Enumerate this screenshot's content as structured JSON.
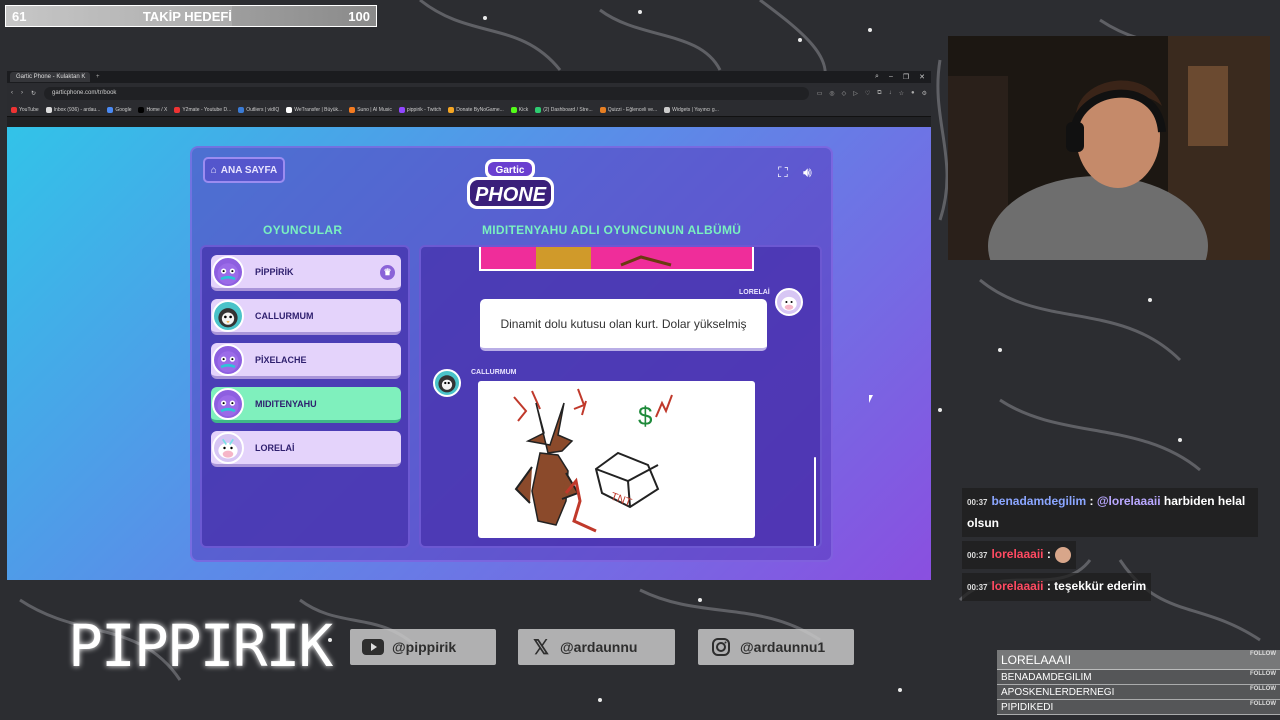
{
  "follower_goal": {
    "current": "61",
    "label": "TAKİP HEDEFİ",
    "target": "100",
    "progress_fraction": 0.61
  },
  "browser": {
    "tab_title": "Gartic Phone - Kulaktan K",
    "url": "garticphone.com/tr/book",
    "bookmarks": [
      "YouTube",
      "Inbox (936) - ardau...",
      "Google",
      "Home / X",
      "Y2mate - Youtube D...",
      "Outliers | vidIQ",
      "WeTransfer | Büyük...",
      "Suno | AI Music",
      "pippirik - Twitch",
      "Donate ByNoGame...",
      "Kick",
      "(2) Dashboard / Stre...",
      "Quizzi - Eğlenceli ve...",
      "Widgets | Yayıncı g..."
    ]
  },
  "game": {
    "home_button": "ANA SAYFA",
    "logo_top": "Gartic",
    "logo_bottom": "PHONE",
    "players_title": "OYUNCULAR",
    "album_title": "MIDITENYAHU ADLI OYUNCUNUN ALBÜMÜ",
    "players": [
      {
        "name": "PİPPİRİK",
        "host": true,
        "active": false
      },
      {
        "name": "CALLURMUM",
        "host": false,
        "active": false
      },
      {
        "name": "PİXELACHE",
        "host": false,
        "active": false
      },
      {
        "name": "MIDITENYAHU",
        "host": false,
        "active": true
      },
      {
        "name": "LORELAİ",
        "host": false,
        "active": false
      }
    ],
    "album": {
      "text_author": "LORELAİ",
      "text_entry": "Dinamit dolu kutusu olan kurt. Dolar yükselmiş",
      "drawing_author": "CALLURMUM",
      "drawing_labels": [
        "TNT",
        "$"
      ]
    }
  },
  "chat": [
    {
      "time": "00:37",
      "user": "benadamdegilim",
      "mention": "@lorelaaaii",
      "text": " harbiden helal olsun"
    },
    {
      "time": "00:37",
      "user": "lorelaaaii",
      "text": ""
    },
    {
      "time": "00:37",
      "user": "lorelaaaii",
      "text": "teşekkür ederim"
    }
  ],
  "brand_name": "PIPPIRIK",
  "socials": [
    {
      "icon": "youtube-icon",
      "handle": "@pippirik"
    },
    {
      "icon": "x-icon",
      "handle": "@ardaunnu"
    },
    {
      "icon": "instagram-icon",
      "handle": "@ardaunnu1"
    }
  ],
  "follows": {
    "tag": "FOLLOW",
    "names": [
      "LORELAAAII",
      "BENADAMDEGILIM",
      "APOSKENLERDERNEGI",
      "PIPIDIKEDI"
    ]
  },
  "colors": {
    "accent_green": "#7ff0bd",
    "accent_purple": "#8a4fe0",
    "player_card": "#e4d3fb"
  }
}
